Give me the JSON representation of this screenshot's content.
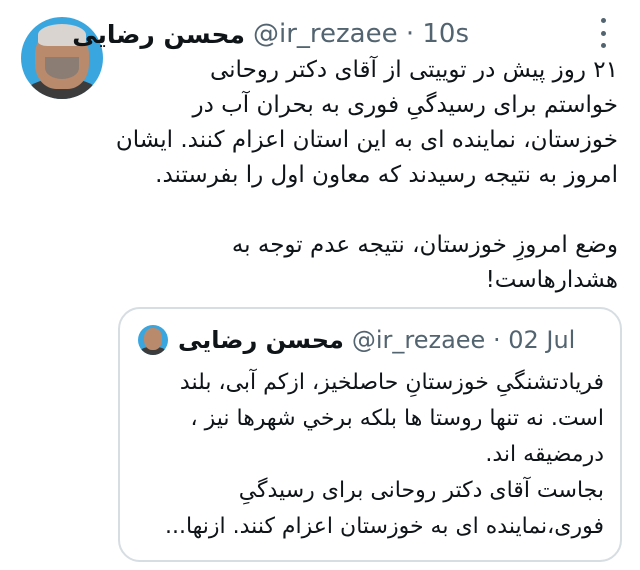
{
  "tweet": {
    "display_name": "محسن رضایی",
    "handle_time": "@ir_rezaee · 10s",
    "lines": [
      "۲۱ روز پیش در توییتی از آقای دکتر روحانی",
      "خواستم برای رسیدگیِ فوری به بحران آب در",
      "خوزستان، نماینده ای به این استان اعزام کنند. ایشان",
      "امروز به نتیجه رسیدند که معاون اول را بفرستند.",
      "وضع امروزِ خوزستان، نتیجه عدم توجه به",
      "هشدارهاست!"
    ]
  },
  "quoted_tweet": {
    "display_name": "محسن رضایی",
    "handle_time": "@ir_rezaee · 02 Jul",
    "lines": [
      "فریادتشنگیِ خوزستانِ حاصلخیز، ازکم آبی، بلند",
      "است. نه تنها روستا ها بلکه برخي شهرها نیز ،",
      "درمضیقه اند.",
      "بجاست آقای دکتر روحانی برای رسیدگیِ",
      "فوری،نماینده ای به خوزستان اعزام کنند. ازنها..."
    ]
  },
  "icons": {
    "more": "more-vertical-icon",
    "avatar": "profile-avatar"
  },
  "colors": {
    "avatar_bg": "#3aa6e0",
    "secondary_text": "#536471",
    "border": "#d6dde3"
  }
}
